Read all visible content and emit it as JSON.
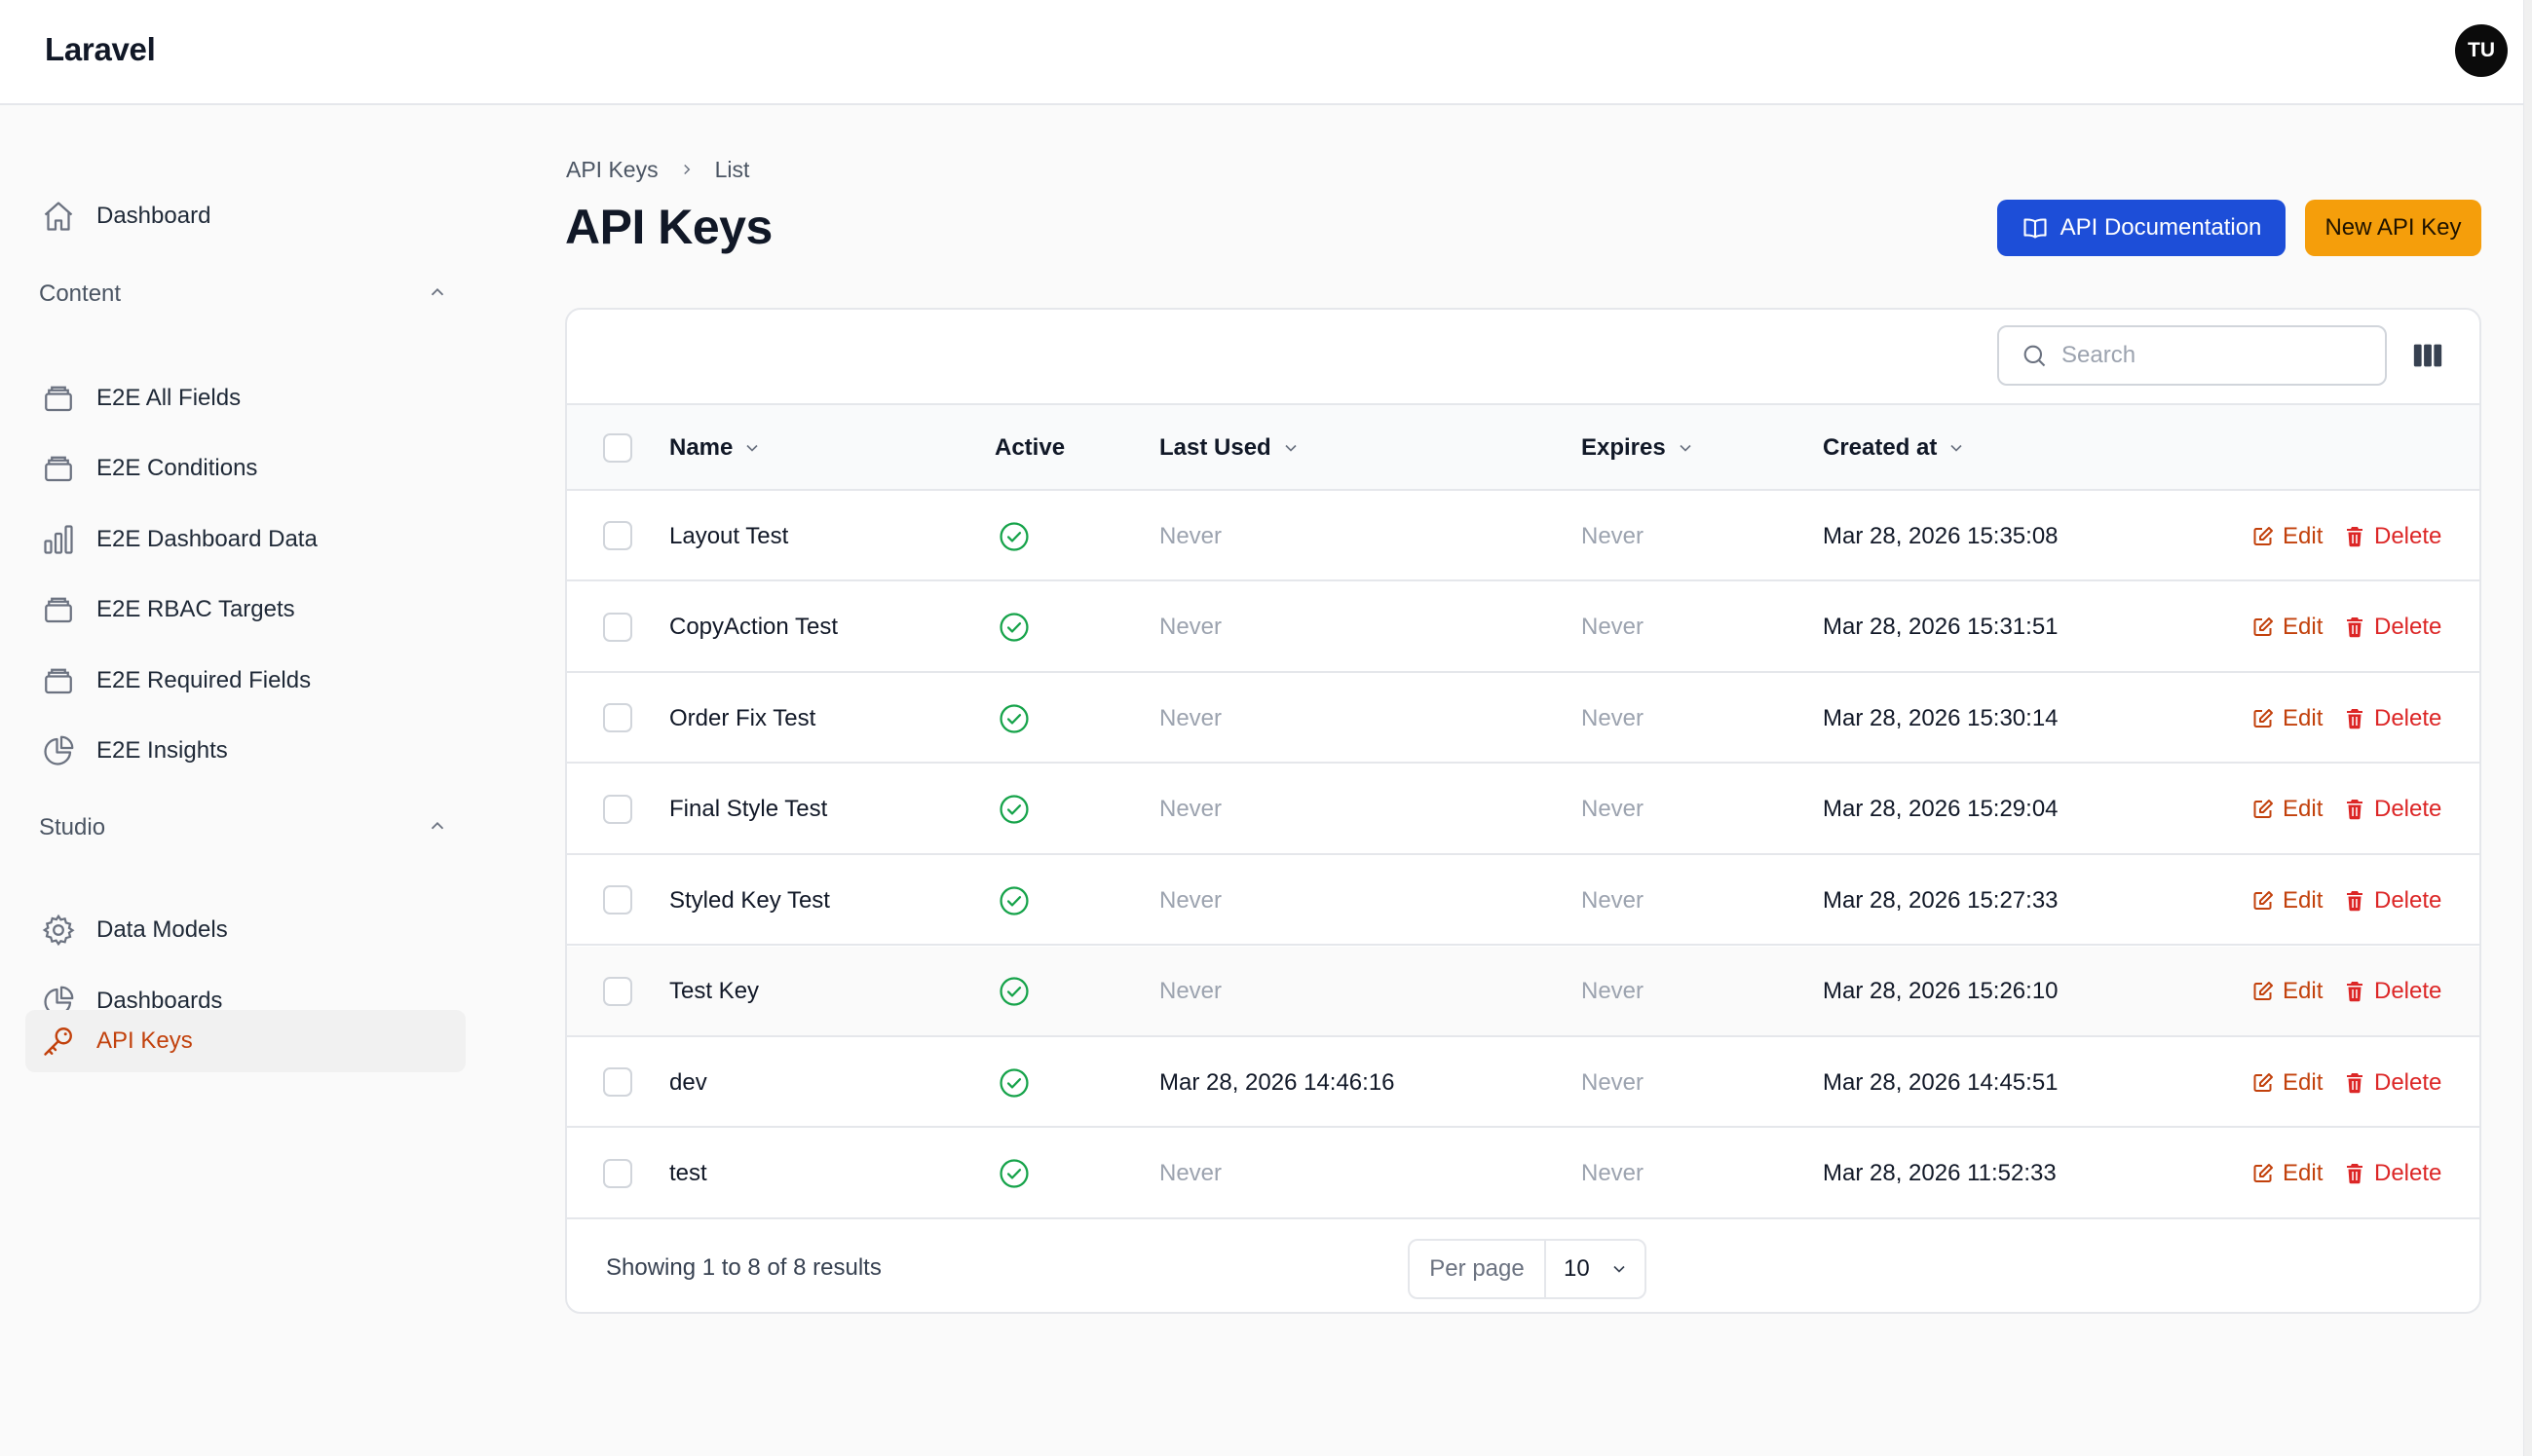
{
  "app": {
    "brand": "Laravel",
    "user_initials": "TU"
  },
  "sidebar": {
    "dashboard": "Dashboard",
    "groups": [
      {
        "label": "Content",
        "items": [
          {
            "label": "E2E All Fields",
            "icon": "stack-icon"
          },
          {
            "label": "E2E Conditions",
            "icon": "stack-icon"
          },
          {
            "label": "E2E Dashboard Data",
            "icon": "bar-chart-icon"
          },
          {
            "label": "E2E RBAC Targets",
            "icon": "stack-icon"
          },
          {
            "label": "E2E Required Fields",
            "icon": "stack-icon"
          },
          {
            "label": "E2E Insights",
            "icon": "pie-chart-icon"
          }
        ]
      },
      {
        "label": "Studio",
        "items": [
          {
            "label": "Data Models",
            "icon": "gear-icon"
          },
          {
            "label": "Dashboards",
            "icon": "pie-chart-icon"
          },
          {
            "label": "API Keys",
            "icon": "key-icon",
            "active": true
          }
        ]
      }
    ]
  },
  "breadcrumb": {
    "parent": "API Keys",
    "current": "List"
  },
  "page": {
    "title": "API Keys",
    "docs_button": "API Documentation",
    "new_button": "New API Key"
  },
  "table": {
    "search_placeholder": "Search",
    "columns": {
      "name": "Name",
      "active": "Active",
      "last_used": "Last Used",
      "expires": "Expires",
      "created_at": "Created at"
    },
    "actions": {
      "edit": "Edit",
      "delete": "Delete"
    },
    "rows": [
      {
        "name": "Layout Test",
        "active": true,
        "last_used": "Never",
        "expires": "Never",
        "created_at": "Mar 28, 2026 15:35:08"
      },
      {
        "name": "CopyAction Test",
        "active": true,
        "last_used": "Never",
        "expires": "Never",
        "created_at": "Mar 28, 2026 15:31:51"
      },
      {
        "name": "Order Fix Test",
        "active": true,
        "last_used": "Never",
        "expires": "Never",
        "created_at": "Mar 28, 2026 15:30:14"
      },
      {
        "name": "Final Style Test",
        "active": true,
        "last_used": "Never",
        "expires": "Never",
        "created_at": "Mar 28, 2026 15:29:04"
      },
      {
        "name": "Styled Key Test",
        "active": true,
        "last_used": "Never",
        "expires": "Never",
        "created_at": "Mar 28, 2026 15:27:33"
      },
      {
        "name": "Test Key",
        "active": true,
        "last_used": "Never",
        "expires": "Never",
        "created_at": "Mar 28, 2026 15:26:10"
      },
      {
        "name": "dev",
        "active": true,
        "last_used": "Mar 28, 2026 14:46:16",
        "expires": "Never",
        "created_at": "Mar 28, 2026 14:45:51"
      },
      {
        "name": "test",
        "active": true,
        "last_used": "Never",
        "expires": "Never",
        "created_at": "Mar 28, 2026 11:52:33"
      }
    ],
    "showing": "Showing 1 to 8 of 8 results",
    "per_page_label": "Per page",
    "per_page_value": "10"
  },
  "colors": {
    "primary": "#1d4ed8",
    "warning": "#f59e0b",
    "success": "#16a34a",
    "danger": "#dc2626",
    "accent": "#c2410c"
  }
}
